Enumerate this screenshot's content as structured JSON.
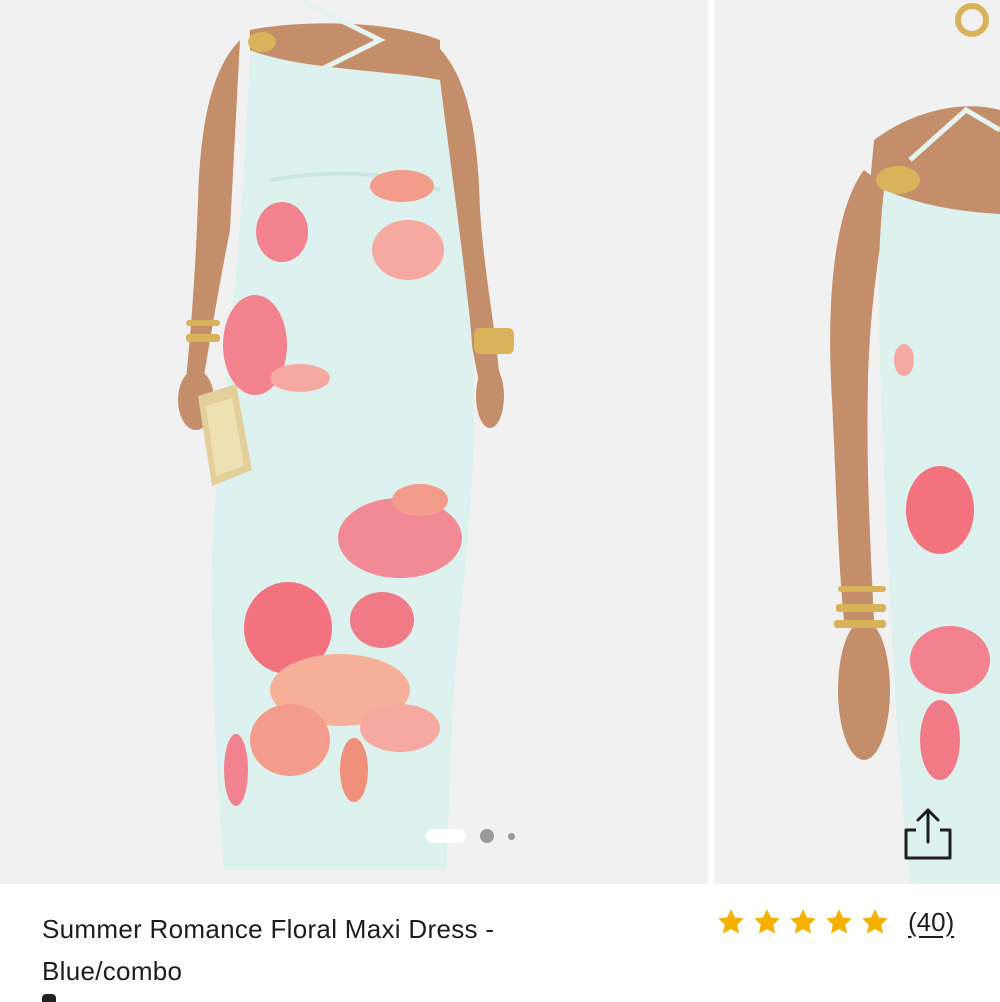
{
  "product": {
    "title": "Summer Romance Floral Maxi Dress - Blue/combo",
    "rating_value": 5,
    "rating_max": 5,
    "review_count_label": "(40)"
  },
  "gallery": {
    "image_count": 3,
    "active_index": 0,
    "images": [
      {
        "name": "Model front view wearing light blue floral maxi dress with gold clutch"
      },
      {
        "name": "Model side view wearing light blue floral maxi dress"
      }
    ]
  },
  "icons": {
    "share": "share-icon",
    "star": "star-icon"
  },
  "colors": {
    "star": "#F5B100",
    "text": "#1D1D1D",
    "dress": "#DDF1EF",
    "flower": "#F07A86",
    "dot_inactive": "#9A9A9A"
  }
}
